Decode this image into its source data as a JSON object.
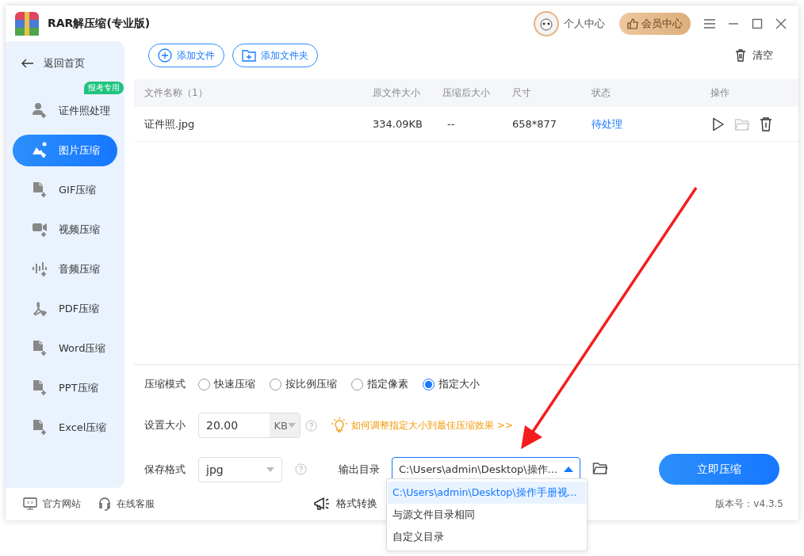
{
  "window": {
    "title": "RAR解压缩(专业版)"
  },
  "header": {
    "user": "个人中心",
    "vip": "会员中心"
  },
  "sidebar": {
    "back": "返回首页",
    "items": [
      {
        "kind": "person",
        "label": "证件照处理",
        "badge": "报考专用",
        "selected": false
      },
      {
        "kind": "image",
        "label": "图片压缩",
        "selected": true
      },
      {
        "kind": "doc",
        "label": "GIF压缩",
        "selected": false
      },
      {
        "kind": "video",
        "label": "视频压缩",
        "selected": false
      },
      {
        "kind": "audio",
        "label": "音频压缩",
        "selected": false
      },
      {
        "kind": "pdf",
        "label": "PDF压缩",
        "selected": false
      },
      {
        "kind": "doc",
        "label": "Word压缩",
        "selected": false
      },
      {
        "kind": "doc",
        "label": "PPT压缩",
        "selected": false
      },
      {
        "kind": "doc",
        "label": "Excel压缩",
        "selected": false
      }
    ]
  },
  "toolbar": {
    "add_file": "添加文件",
    "add_folder": "添加文件夹",
    "clear": "清空"
  },
  "table": {
    "columns": [
      "文件名称（1）",
      "原文件大小",
      "压缩后大小",
      "尺寸",
      "状态",
      "操作"
    ],
    "rows": [
      {
        "name": "证件照.jpg",
        "original_size": "334.09KB",
        "compressed_size": "--",
        "dimensions": "658*877",
        "status": "待处理"
      }
    ]
  },
  "settings": {
    "mode_label": "压缩模式",
    "modes": [
      {
        "label": "快速压缩",
        "selected": false
      },
      {
        "label": "按比例压缩",
        "selected": false
      },
      {
        "label": "指定像素",
        "selected": false
      },
      {
        "label": "指定大小",
        "selected": true
      }
    ],
    "size_label": "设置大小",
    "size_value": "20.00",
    "size_unit": "KB",
    "tip": "如何调整指定大小到最佳压缩效果 >>",
    "format_label": "保存格式",
    "format_value": "jpg",
    "output_label": "输出目录",
    "output_value": "C:\\Users\\admin\\Desktop\\操作...",
    "output_options": [
      {
        "label": "C:\\Users\\admin\\Desktop\\操作手册视...",
        "selected": true
      },
      {
        "label": "与源文件目录相同",
        "selected": false
      },
      {
        "label": "自定义目录",
        "selected": false
      }
    ],
    "start": "立即压缩"
  },
  "footer": {
    "website": "官方网站",
    "support": "在线客服",
    "convert": "格式转换",
    "version": "版本号：v4.3.5"
  }
}
